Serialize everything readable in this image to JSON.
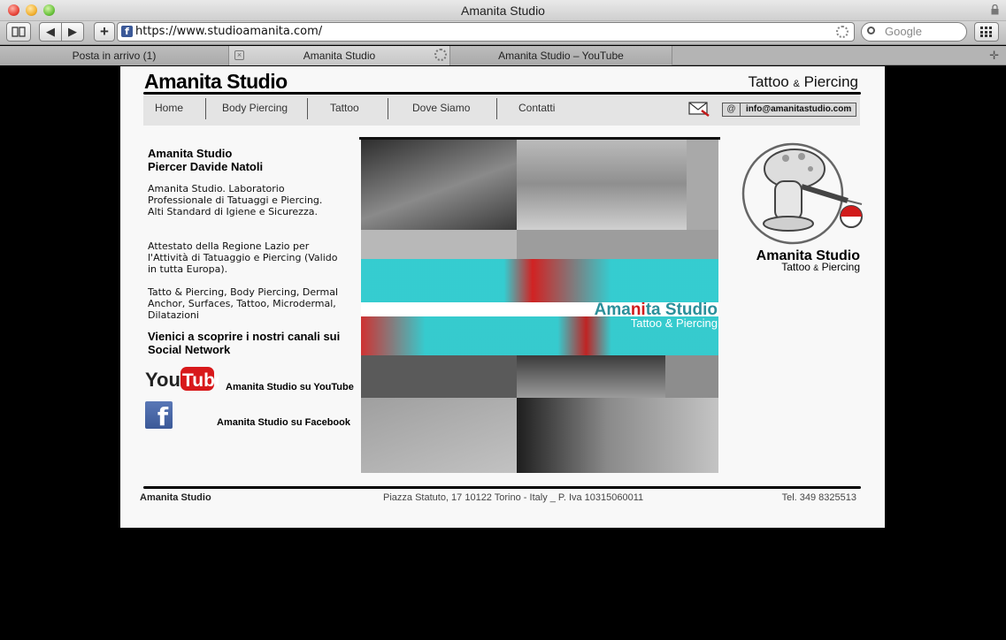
{
  "browser": {
    "window_title": "Amanita Studio",
    "url": "https://www.studioamanita.com/",
    "search_placeholder": "Google",
    "tabs": [
      {
        "label": "Posta in arrivo (1)"
      },
      {
        "label": "Amanita Studio"
      },
      {
        "label": "Amanita Studio – YouTube"
      }
    ]
  },
  "header": {
    "logo": "Amanita Studio",
    "subtitle_a": "Tattoo",
    "subtitle_amp": "&",
    "subtitle_b": "Piercing"
  },
  "nav": {
    "items": [
      "Home",
      "Body Piercing",
      "Tattoo",
      "Dove Siamo",
      "Contatti"
    ],
    "email_at": "@",
    "email": "info@amanitastudio.com"
  },
  "sidebar": {
    "heading1": "Amanita Studio",
    "heading2": "Piercer Davide Natoli",
    "para1": "Amanita Studio. Laboratorio Professionale di Tatuaggi e Piercing. Alti Standard di Igiene e Sicurezza.",
    "para2": "Attestato della Regione Lazio per l'Attività di Tatuaggio e Piercing (Valido in tutta Europa).",
    "para3": "Tatto & Piercing, Body Piercing, Dermal Anchor, Surfaces, Tattoo, Microdermal, Dilatazioni",
    "social_heading": "Vienici a scoprire i nostri canali sui Social Network",
    "youtube_logo": "YouTube",
    "youtube_label": "Amanita Studio su YouTube",
    "facebook_logo": "f",
    "facebook_label": "Amanita Studio su Facebook"
  },
  "hero": {
    "brand_a": "Ama",
    "brand_b": "ni",
    "brand_c": "ta Studio",
    "sub": "Tattoo & Piercing"
  },
  "brand_badge": {
    "name": "Amanita Studio",
    "sub_a": "Tattoo",
    "sub_amp": "&",
    "sub_b": "Piercing"
  },
  "footer": {
    "left": "Amanita Studio",
    "address": "Piazza Statuto, 17 10122 Torino - Italy _ P. Iva 10315060011",
    "phone": "Tel. 349 8325513"
  },
  "colors": {
    "accent_cyan": "#2fd4d8",
    "accent_red": "#d11b1b",
    "facebook_blue": "#3b5998"
  }
}
